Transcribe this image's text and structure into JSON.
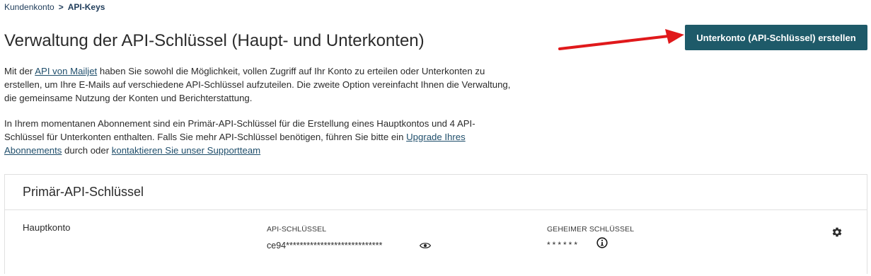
{
  "breadcrumb": {
    "parent": "Kundenkonto",
    "separator": ">",
    "current": "API-Keys"
  },
  "page_title": "Verwaltung der API-Schlüssel (Haupt- und Unterkonten)",
  "create_button_label": "Unterkonto (API-Schlüssel) erstellen",
  "annotation_arrow_color": "#e0191b",
  "intro": {
    "p1_before": "Mit der ",
    "p1_link": "API von Mailjet",
    "p1_after": " haben Sie sowohl die Möglichkeit, vollen Zugriff auf Ihr Konto zu erteilen oder Unterkonten zu erstellen, um Ihre E-Mails auf verschiedene API-Schlüssel aufzuteilen. Die zweite Option vereinfacht Ihnen die Verwaltung, die gemeinsame Nutzung der Konten und Berichterstattung.",
    "p2_before": "In Ihrem momentanen Abonnement sind ein Primär-API-Schlüssel für die Erstellung eines Hauptkontos und 4 API-Schlüssel für Unterkonten enthalten. Falls Sie mehr API-Schlüssel benötigen, führen Sie bitte ein ",
    "p2_link1": "Upgrade Ihres Abonnements",
    "p2_middle": " durch oder ",
    "p2_link2": "kontaktieren Sie unser Supportteam"
  },
  "primary_card": {
    "title": "Primär-API-Schlüssel",
    "account_name": "Hauptkonto",
    "api_key_label": "API-SCHLÜSSEL",
    "api_key_value": "ce94****************************",
    "secret_label": "GEHEIMER SCHLÜSSEL",
    "secret_value": "******"
  },
  "icons": {
    "reveal": "eye-icon",
    "info": "info-icon",
    "settings": "gear-icon"
  },
  "colors": {
    "button_bg": "#1e5a69",
    "link": "#1f4e6b"
  }
}
